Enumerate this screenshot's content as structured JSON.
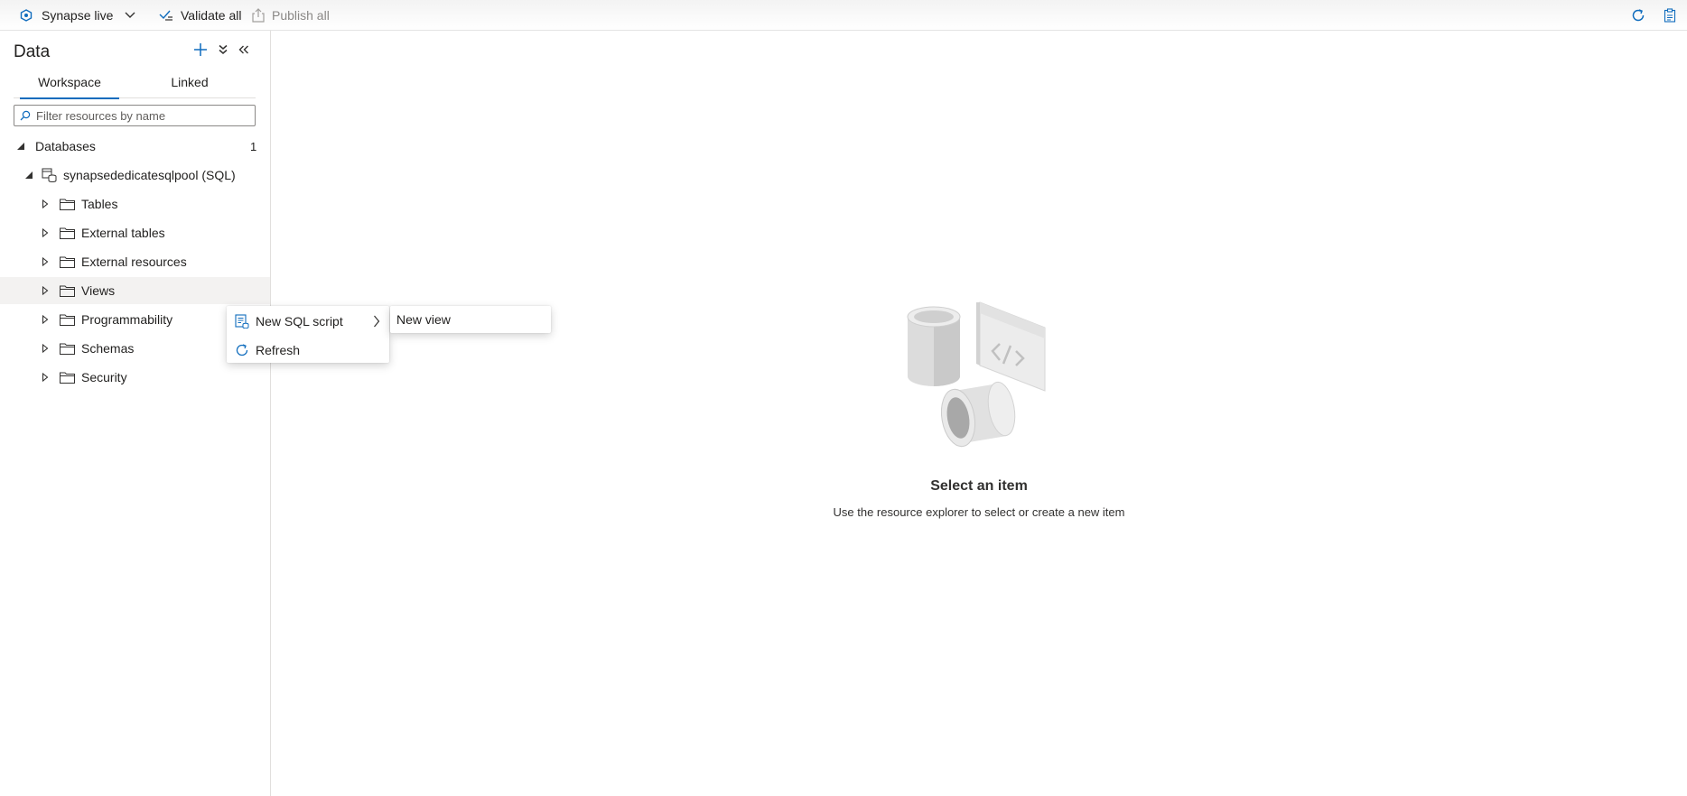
{
  "toolbar": {
    "live_label": "Synapse live",
    "validate_label": "Validate all",
    "publish_label": "Publish all"
  },
  "panel": {
    "title": "Data",
    "tabs": [
      "Workspace",
      "Linked"
    ],
    "active_tab": "Workspace",
    "filter_placeholder": "Filter resources by name"
  },
  "tree": {
    "section_label": "Databases",
    "section_count": "1",
    "database_label": "synapsededicatesqlpool (SQL)",
    "folders": [
      "Tables",
      "External tables",
      "External resources",
      "Views",
      "Programmability",
      "Schemas",
      "Security"
    ],
    "hovered_folder": "Views"
  },
  "context_menu": {
    "items": [
      "New SQL script",
      "Refresh"
    ],
    "submenu_items": [
      "New view"
    ]
  },
  "empty_state": {
    "title": "Select an item",
    "subtitle": "Use the resource explorer to select or create a new item"
  },
  "colors": {
    "accent": "#0f6cbd",
    "text": "#201f1e",
    "muted": "#8a8886",
    "hover": "#f3f2f1"
  }
}
